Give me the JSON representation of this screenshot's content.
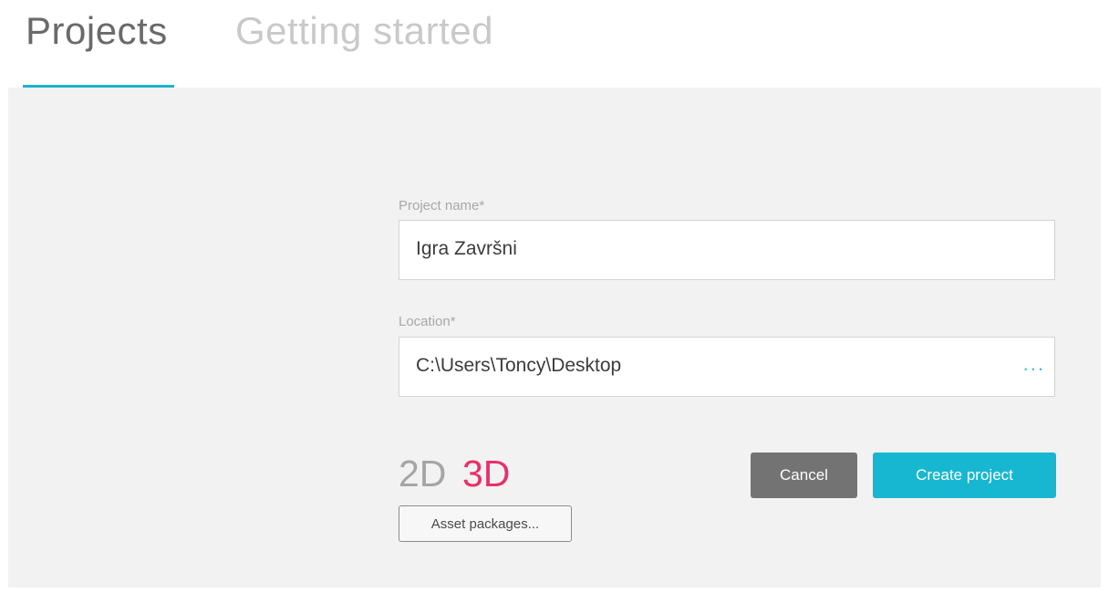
{
  "tabs": [
    {
      "label": "Projects",
      "active": true
    },
    {
      "label": "Getting started",
      "active": false
    }
  ],
  "form": {
    "project_name": {
      "label": "Project name*",
      "value": "Igra Završni"
    },
    "location": {
      "label": "Location*",
      "value": "C:\\Users\\Toncy\\Desktop",
      "browse_label": "..."
    }
  },
  "mode": {
    "option_2d": "2D",
    "option_3d": "3D",
    "selected": "3D"
  },
  "buttons": {
    "cancel": "Cancel",
    "create": "Create project",
    "asset_packages": "Asset packages..."
  },
  "colors": {
    "accent": "#1ab5cf",
    "selected_mode": "#e8306a",
    "cancel_bg": "#737373",
    "panel_bg": "#f2f2f2"
  }
}
